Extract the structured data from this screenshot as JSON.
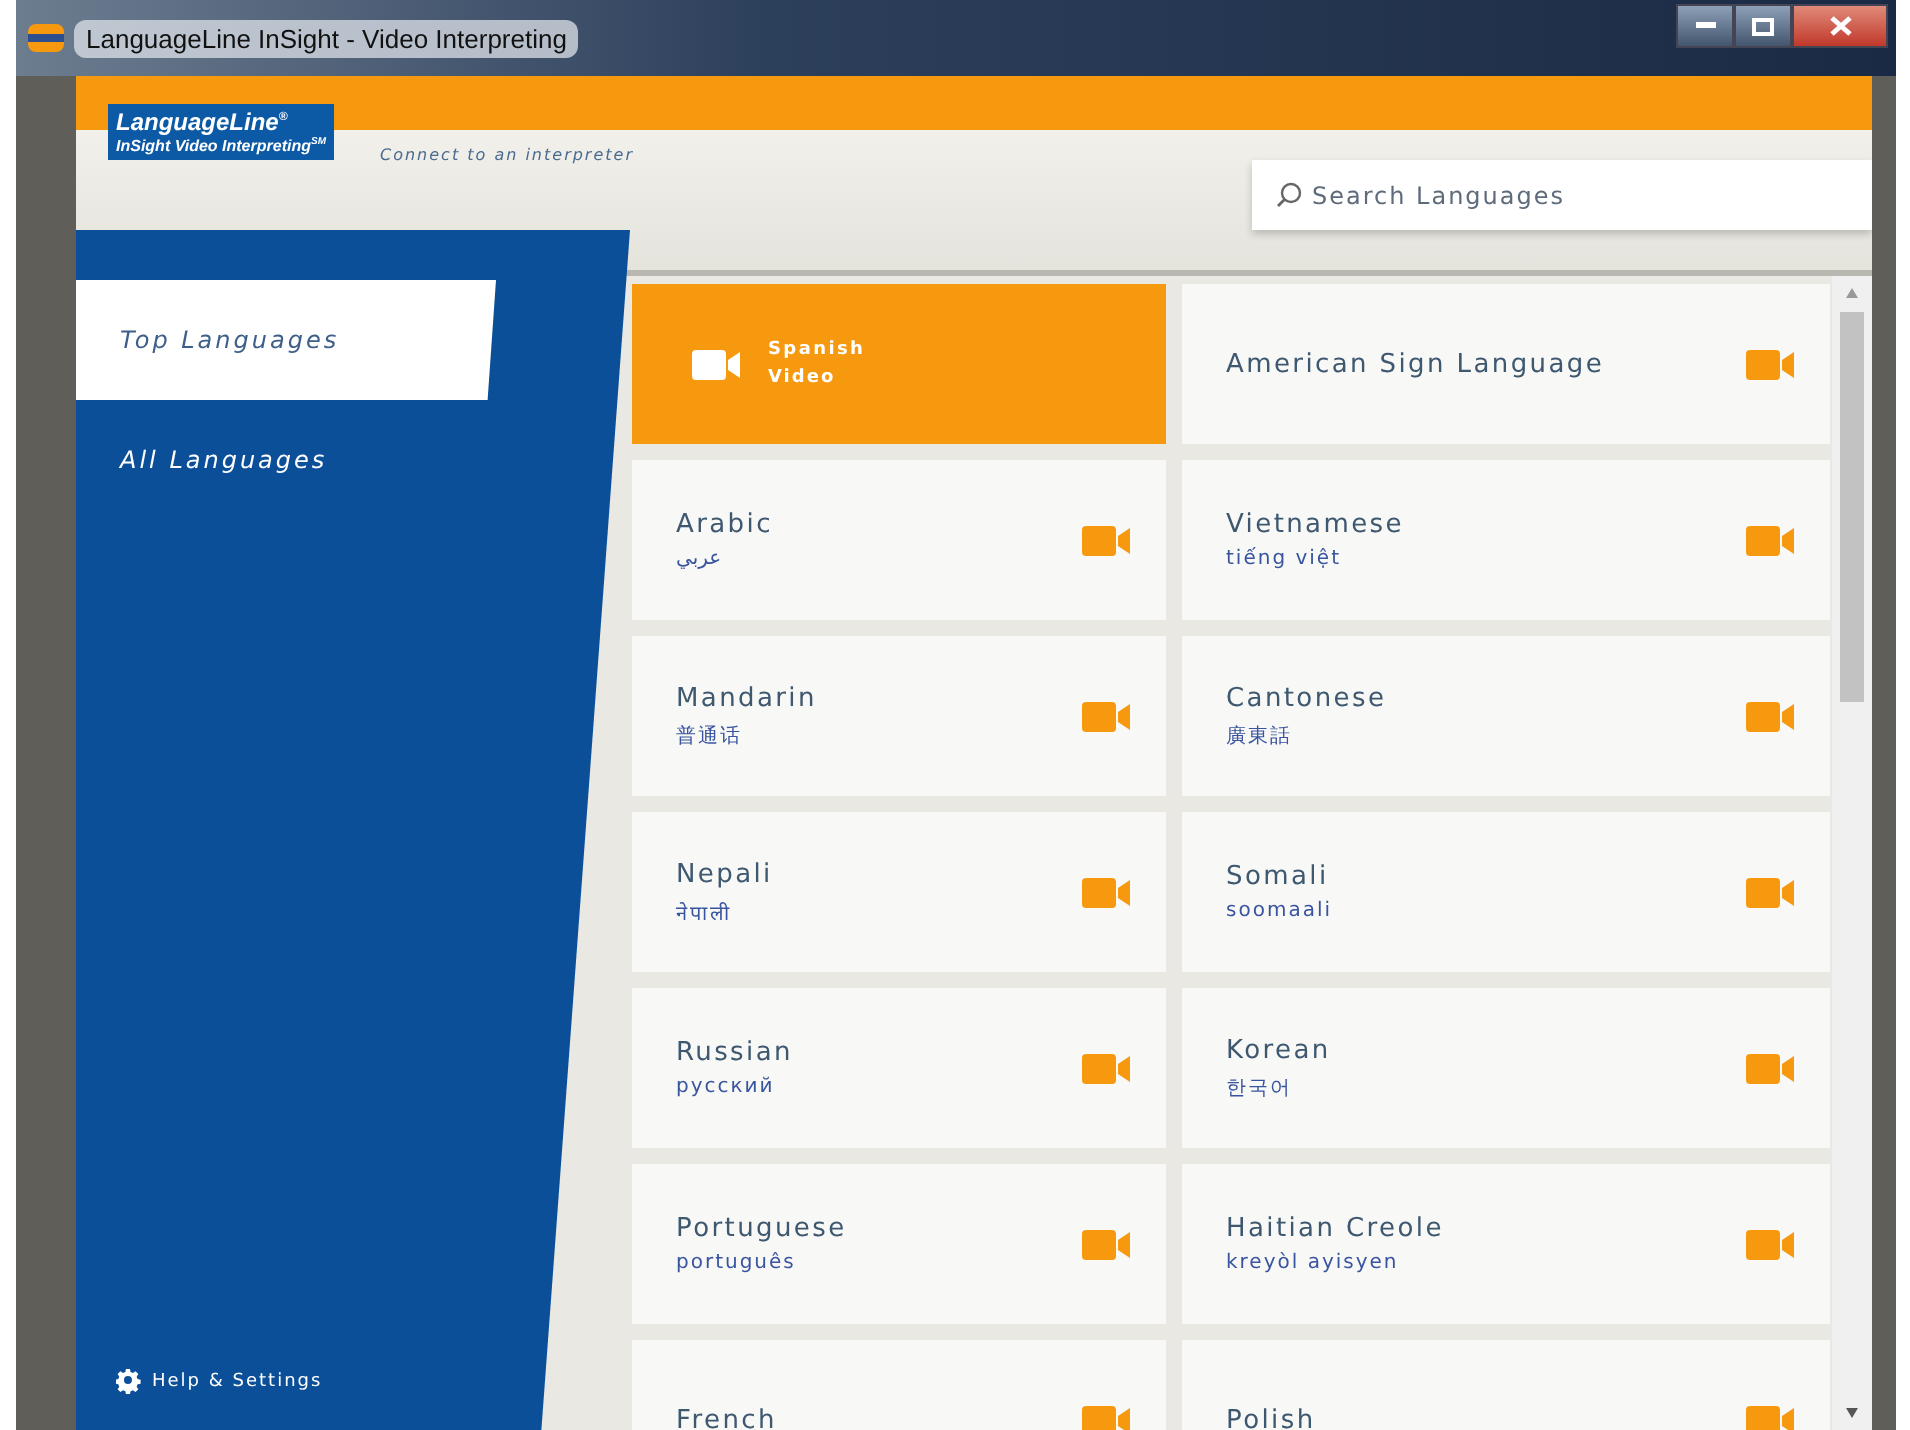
{
  "window": {
    "title": "LanguageLine InSight - Video Interpreting"
  },
  "header": {
    "logo_line_1": "LanguageLine",
    "logo_mark": "®",
    "logo_line_2": "InSight Video Interpreting",
    "logo_sup": "SM",
    "tagline": "Connect to an interpreter"
  },
  "search": {
    "placeholder": "Search Languages"
  },
  "sidebar": {
    "items": [
      {
        "label": "Top Languages",
        "selected": true
      },
      {
        "label": "All Languages",
        "selected": false
      }
    ],
    "footer": "Help & Settings"
  },
  "tiles": [
    {
      "kind": "featured",
      "name": "Spanish",
      "native": "Video"
    },
    {
      "kind": "language",
      "name": "American Sign Language"
    },
    {
      "kind": "language",
      "name": "Arabic",
      "native": "عربي"
    },
    {
      "kind": "language",
      "name": "Vietnamese",
      "native": "tiếng việt"
    },
    {
      "kind": "language",
      "name": "Mandarin",
      "native": "普通话"
    },
    {
      "kind": "language",
      "name": "Cantonese",
      "native": "廣東話"
    },
    {
      "kind": "language",
      "name": "Nepali",
      "native": "नेपाली"
    },
    {
      "kind": "language",
      "name": "Somali",
      "native": "soomaali"
    },
    {
      "kind": "language",
      "name": "Russian",
      "native": "русский"
    },
    {
      "kind": "language",
      "name": "Korean",
      "native": "한국어"
    },
    {
      "kind": "language",
      "name": "Portuguese",
      "native": "português"
    },
    {
      "kind": "language",
      "name": "Haitian Creole",
      "native": "kreyòl ayisyen"
    },
    {
      "kind": "language",
      "name": "French"
    },
    {
      "kind": "language",
      "name": "Polish"
    }
  ]
}
